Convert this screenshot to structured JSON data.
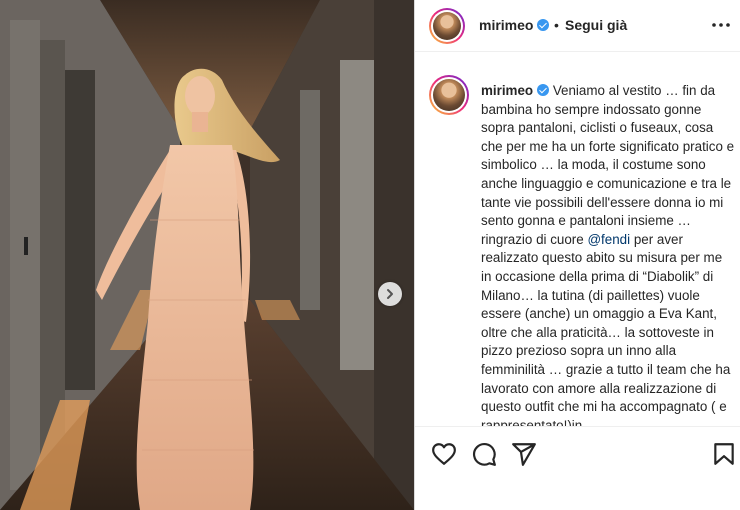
{
  "post": {
    "username": "mirimeo",
    "separator": "•",
    "follow_status": "Segui già",
    "more_icon": "more-horizontal-icon"
  },
  "caption": {
    "username": "mirimeo",
    "text_before_mention": "Veniamo al vestito … fin da bambina ho sempre indossato gonne sopra pantaloni, ciclisti o fuseaux, cosa che per me ha un forte significato pratico e simbolico … la moda, il costume sono anche linguaggio e comunicazione e tra le tante vie possibili dell'essere donna io mi sento gonna e pantaloni insieme … ringrazio di cuore",
    "mention": "@fendi",
    "text_after_mention": "per aver realizzato questo abito su misura per me in occasione della prima di “Diabolik” di Milano… la tutina (di paillettes) vuole essere (anche) un omaggio a Eva Kant, oltre che alla praticità… la sottoveste in pizzo prezioso sopra un inno alla femminilità … grazie a tutto il team che ha lavorato con amore alla realizzazione di questo outfit che mi ha accompagnato ( e rappresentato!)in"
  },
  "actions": {
    "like_icon": "heart-icon",
    "comment_icon": "comment-icon",
    "share_icon": "share-icon",
    "save_icon": "bookmark-icon"
  },
  "carousel": {
    "next_icon": "chevron-right-icon"
  },
  "colors": {
    "verified": "#3897f0",
    "mention": "#00376b",
    "text": "#262626"
  }
}
